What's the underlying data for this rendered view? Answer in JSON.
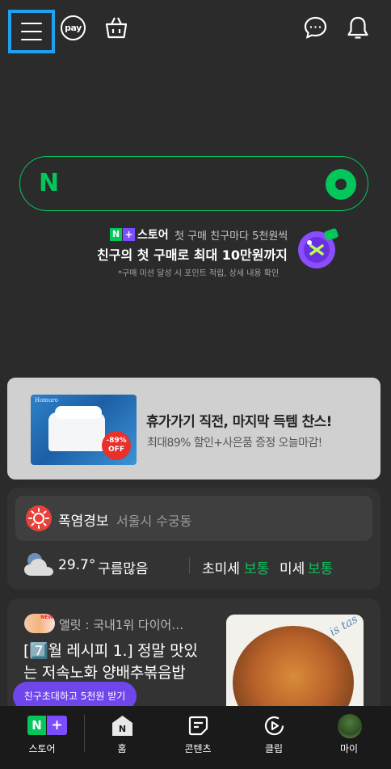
{
  "header": {
    "pay_label": "pay"
  },
  "search": {
    "logo": "N",
    "placeholder": ""
  },
  "promo": {
    "badge_n": "N",
    "badge_plus": "+",
    "store_label": "스토어",
    "subtitle": "첫 구매 친구마다 5천원씩",
    "title": "친구의 첫 구매로 최대 10만원까지",
    "note": "*구매 미션 달성 시 포인트 적립, 상세 내용 확인"
  },
  "ad": {
    "brand": "Homuro",
    "discount_line1": "-89%",
    "discount_line2": "OFF",
    "title": "휴가가기 직전, 마지막 득템 찬스!",
    "subtitle": "최대89% 할인+사은품 증정 오늘마감!"
  },
  "weather": {
    "alert_type": "폭염경보",
    "alert_location": "서울시 수궁동",
    "temperature": "29.7°",
    "sky": "구름많음",
    "fine_dust_label": "초미세",
    "fine_dust_value": "보통",
    "dust_label": "미세",
    "dust_value": "보통"
  },
  "content": {
    "avatar_tag": "NEW",
    "author": "앨릿 : 국내1위 다이어…",
    "title": "[7️⃣월 레시피 1.] 정말 맛있는 저속노화 양배추볶음밥",
    "image_caption": "is tas",
    "invite_label": "친구초대하고 5천원 받기"
  },
  "nav": {
    "store_badge_n": "N",
    "store_badge_plus": "+",
    "items": [
      {
        "label": "스토어"
      },
      {
        "label": "홈"
      },
      {
        "label": "콘텐츠"
      },
      {
        "label": "클립"
      },
      {
        "label": "마이"
      }
    ]
  },
  "colors": {
    "background": "#2b2b2b",
    "naver_green": "#03c75a",
    "plus_purple": "#7b4dff",
    "invite_purple": "#6f46ec",
    "highlight_blue": "#1ea1f2"
  }
}
